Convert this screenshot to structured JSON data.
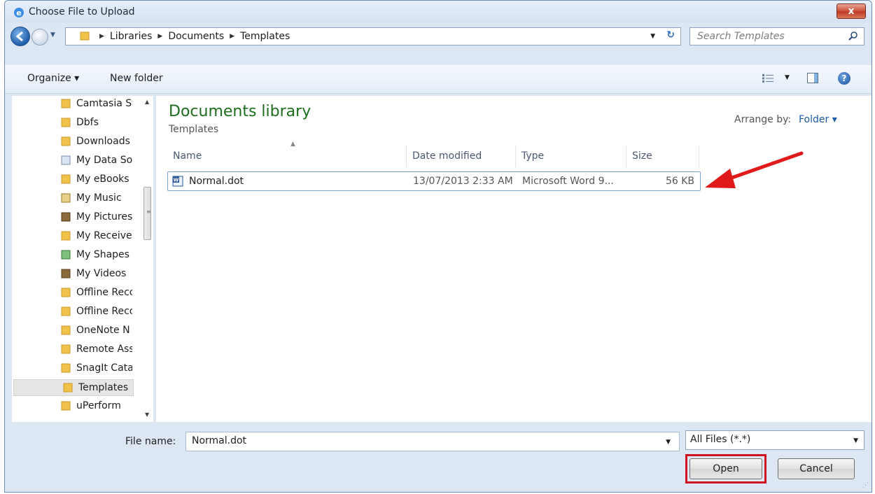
{
  "window": {
    "title": "Choose File to Upload",
    "close_glyph": "x"
  },
  "address": {
    "breadcrumbs": [
      "Libraries",
      "Documents",
      "Templates"
    ],
    "search_placeholder": "Search Templates"
  },
  "toolbar": {
    "organize_label": "Organize ▾",
    "new_folder_label": "New folder"
  },
  "navigation": {
    "items": [
      {
        "label": "Camtasia St",
        "icon": "folder-icon"
      },
      {
        "label": "Dbfs",
        "icon": "folder-icon"
      },
      {
        "label": "Downloads",
        "icon": "folder-icon"
      },
      {
        "label": "My Data Sou",
        "icon": "data-sources-icon"
      },
      {
        "label": "My eBooks",
        "icon": "folder-icon"
      },
      {
        "label": "My Music",
        "icon": "music-folder-icon"
      },
      {
        "label": "My Pictures",
        "icon": "pictures-folder-icon"
      },
      {
        "label": "My Receive",
        "icon": "folder-icon"
      },
      {
        "label": "My Shapes",
        "icon": "shapes-folder-icon"
      },
      {
        "label": "My Videos",
        "icon": "videos-folder-icon"
      },
      {
        "label": "Offline Recc",
        "icon": "folder-icon"
      },
      {
        "label": "Offline Recc",
        "icon": "folder-icon"
      },
      {
        "label": "OneNote N",
        "icon": "folder-icon"
      },
      {
        "label": "Remote Ass",
        "icon": "folder-icon"
      },
      {
        "label": "SnagIt Catal",
        "icon": "folder-icon"
      },
      {
        "label": "Templates",
        "icon": "folder-icon",
        "selected": true
      },
      {
        "label": "uPerform",
        "icon": "folder-icon"
      }
    ]
  },
  "content": {
    "library_title": "Documents library",
    "library_subtitle": "Templates",
    "arrange_label": "Arrange by:",
    "arrange_value": "Folder ▾",
    "columns": {
      "name": "Name",
      "date": "Date modified",
      "type": "Type",
      "size": "Size"
    },
    "files": [
      {
        "name": "Normal.dot",
        "date": "13/07/2013 2:33 AM",
        "type": "Microsoft Word 9...",
        "size": "56 KB"
      }
    ]
  },
  "footer": {
    "file_name_label": "File name:",
    "file_name_value": "Normal.dot",
    "file_type_value": "All Files (*.*)",
    "open_label": "Open",
    "cancel_label": "Cancel"
  },
  "colors": {
    "library_title": "#1e6e1e",
    "highlight_red": "#d0141f",
    "link_blue": "#1c5aa8"
  }
}
